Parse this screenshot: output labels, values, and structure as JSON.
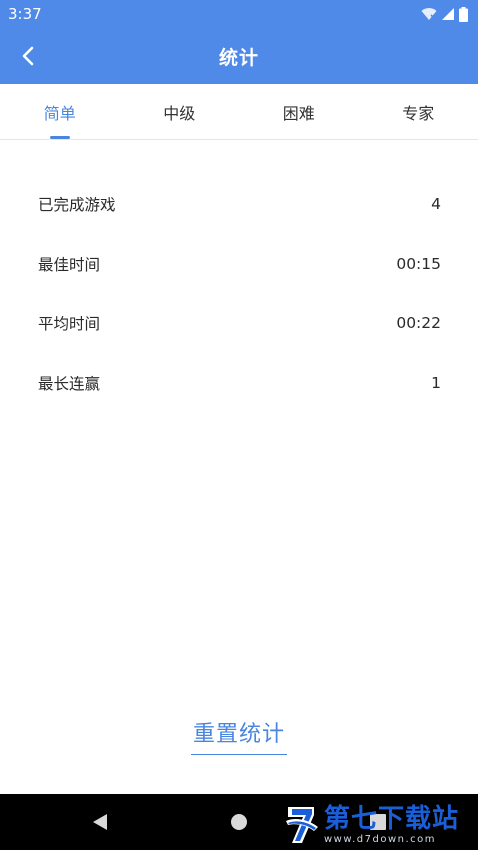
{
  "status_bar": {
    "time": "3:37"
  },
  "app_bar": {
    "title": "统计"
  },
  "tabs": [
    {
      "label": "简单",
      "active": true
    },
    {
      "label": "中级",
      "active": false
    },
    {
      "label": "困难",
      "active": false
    },
    {
      "label": "专家",
      "active": false
    }
  ],
  "stats": [
    {
      "label": "已完成游戏",
      "value": "4"
    },
    {
      "label": "最佳时间",
      "value": "00:15"
    },
    {
      "label": "平均时间",
      "value": "00:22"
    },
    {
      "label": "最长连赢",
      "value": "1"
    }
  ],
  "reset_label": "重置统计",
  "watermark": {
    "main": "第七下载站",
    "sub": "www.d7down.com"
  },
  "colors": {
    "primary": "#4f8ae8",
    "accent": "#4a86e0",
    "watermark": "#1a5fd8"
  }
}
